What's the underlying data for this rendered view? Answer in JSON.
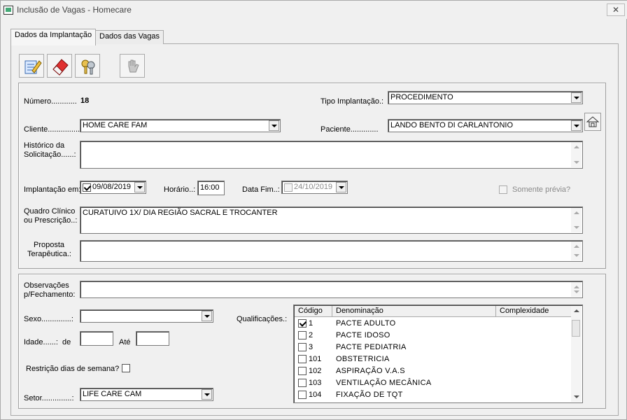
{
  "window": {
    "title": "Inclusão de Vagas - Homecare",
    "close": "✕"
  },
  "tabs": [
    "Dados da Implantação",
    "Dados das Vagas"
  ],
  "toolbar": [
    {
      "icon": "edit-document-icon"
    },
    {
      "icon": "eraser-icon"
    },
    {
      "icon": "keys-icon"
    },
    {
      "icon": "hand-disabled-icon"
    }
  ],
  "top": {
    "numero_label": "Número............",
    "numero_value": "18",
    "tipo_label": "Tipo Implantação.:",
    "tipo_value": "PROCEDIMENTO",
    "cliente_label": "Cliente...............",
    "cliente_value": "HOME CARE FAM",
    "paciente_label": "Paciente.............",
    "paciente_value": "LANDO BENTO DI CARLANTONIO",
    "historico_label_1": "Histórico da",
    "historico_label_2": "Solicitação......:",
    "historico_value": "",
    "implantacao_label": "Implantação em:",
    "implantacao_value": "09/08/2019",
    "horario_label": "Horário..:",
    "horario_value": "16:00",
    "datafim_label": "Data Fim..:",
    "datafim_value": "24/10/2019",
    "somente_label": "Somente prévia?",
    "quadro_label_1": "Quadro Clínico",
    "quadro_label_2": "ou Prescrição..:",
    "quadro_value": "CURATUIVO 1X/ DIA REGIÃO SACRAL E TROCANTER",
    "proposta_label_1": "Proposta",
    "proposta_label_2": "Terapêutica.:",
    "proposta_value": ""
  },
  "bottom": {
    "obs_label_1": "Observações",
    "obs_label_2": "p/Fechamento:",
    "sexo_label": "Sexo..............:",
    "sexo_value": "",
    "idade_label": "Idade......:",
    "idade_de_label": "de",
    "idade_ate_label": "Até",
    "idade_de": "",
    "idade_ate": "",
    "restricao_label": "Restrição dias de semana?",
    "setor_label": "Setor..............:",
    "setor_value": "LIFE CARE CAM",
    "qualificacoes_label": "Qualificações.:",
    "grid_headers": [
      "Código",
      "Denominação",
      "Complexidade"
    ],
    "grid_rows": [
      {
        "codigo": "1",
        "denominacao": "PACTE ADULTO",
        "checked": true
      },
      {
        "codigo": "2",
        "denominacao": "PACTE IDOSO",
        "checked": false
      },
      {
        "codigo": "3",
        "denominacao": "PACTE PEDIATRIA",
        "checked": false
      },
      {
        "codigo": "101",
        "denominacao": "OBSTETRICIA",
        "checked": false
      },
      {
        "codigo": "102",
        "denominacao": "ASPIRAÇÃO V.A.S",
        "checked": false
      },
      {
        "codigo": "103",
        "denominacao": "VENTILAÇÃO MECÂNICA",
        "checked": false
      },
      {
        "codigo": "104",
        "denominacao": "FIXAÇÃO DE TQT",
        "checked": false
      }
    ]
  }
}
